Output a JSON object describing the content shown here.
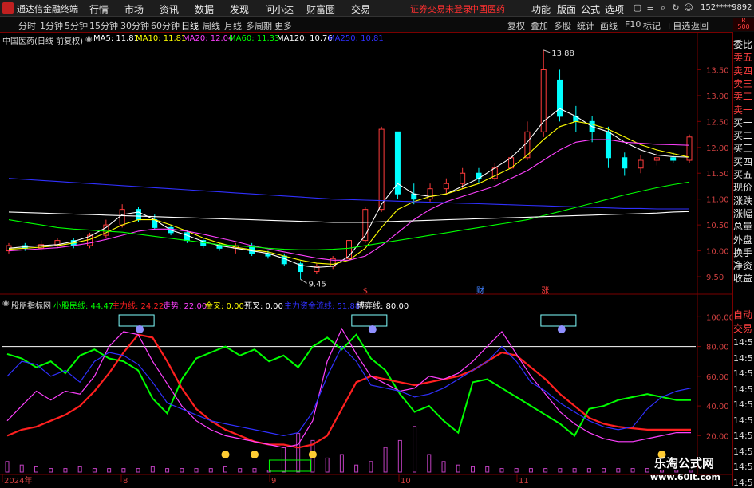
{
  "titlebar": {
    "app_title": "通达信金融终端",
    "menus": [
      "行情",
      "市场",
      "资讯",
      "数据",
      "发现",
      "问小达",
      "财富圈",
      "交易"
    ],
    "warning": "证券交易未登录",
    "stock_name": "中国医药",
    "right_menus": [
      "功能",
      "版面",
      "公式",
      "选项"
    ],
    "phone": "152****9892"
  },
  "toolbar": {
    "periods": [
      "分时",
      "1分钟",
      "5分钟",
      "15分钟",
      "30分钟",
      "60分钟",
      "日线",
      "周线",
      "月线",
      "多周期",
      "更多"
    ],
    "active_period": "日线",
    "right_buttons": [
      "复权",
      "叠加",
      "多股",
      "统计",
      "画线",
      "F10",
      "标记",
      "+自选",
      "返回"
    ]
  },
  "main_chart_info": {
    "title": "中国医药(日线 前复权)",
    "ma": [
      {
        "label": "MA5: 11.81",
        "color": "#ffffff"
      },
      {
        "label": "MA10: 11.81",
        "color": "#ffff00"
      },
      {
        "label": "MA20: 12.04",
        "color": "#ff40ff"
      },
      {
        "label": "MA60: 11.33",
        "color": "#00ff00"
      },
      {
        "label": "MA120: 10.76",
        "color": "#ffffff"
      },
      {
        "label": "MA250: 10.81",
        "color": "#3030ff"
      }
    ]
  },
  "indicator_info": {
    "title": "股朋指标网",
    "items": [
      {
        "label": "小股民线: 44.47",
        "color": "#00ff00"
      },
      {
        "label": "主力线: 24.22",
        "color": "#ff2020"
      },
      {
        "label": "走势: 22.00",
        "color": "#ff40ff"
      },
      {
        "label": "金叉: 0.00",
        "color": "#ffff00"
      },
      {
        "label": "死叉: 0.00",
        "color": "#ffffff"
      },
      {
        "label": "主力资金流线: 51.88",
        "color": "#3030ff"
      },
      {
        "label": "博弈线: 80.00",
        "color": "#ffffff"
      }
    ]
  },
  "chart_data": [
    {
      "type": "line",
      "name": "price",
      "y_ticks": [
        13.5,
        13.0,
        12.5,
        12.0,
        11.5,
        11.0,
        10.5,
        10.0,
        9.5
      ],
      "ylim": [
        9.3,
        14.0
      ],
      "annotations": [
        {
          "text": "13.88",
          "value": 13.88
        },
        {
          "text": "9.45",
          "value": 9.45
        }
      ],
      "event_markers": [
        "$",
        "财",
        "涨"
      ],
      "x_labels": [
        "2024年",
        "8",
        "9",
        "10",
        "11"
      ],
      "series": [
        {
          "name": "MA5",
          "color": "#ffffff",
          "values": [
            10.05,
            10.08,
            10.1,
            10.12,
            10.18,
            10.28,
            10.45,
            10.7,
            10.75,
            10.6,
            10.4,
            10.3,
            10.18,
            10.1,
            10.05,
            10.0,
            9.95,
            9.85,
            9.72,
            9.68,
            9.7,
            9.9,
            10.3,
            10.9,
            11.3,
            11.1,
            11.05,
            11.1,
            11.25,
            11.4,
            11.6,
            11.8,
            12.1,
            12.5,
            12.75,
            12.6,
            12.4,
            12.3,
            12.1,
            11.95,
            11.85,
            11.82,
            11.81
          ]
        },
        {
          "name": "MA10",
          "color": "#ffff00",
          "values": [
            10.03,
            10.05,
            10.07,
            10.1,
            10.15,
            10.22,
            10.35,
            10.5,
            10.6,
            10.6,
            10.5,
            10.38,
            10.25,
            10.15,
            10.07,
            10.02,
            9.98,
            9.9,
            9.82,
            9.76,
            9.74,
            9.82,
            10.05,
            10.45,
            10.8,
            10.95,
            11.05,
            11.1,
            11.2,
            11.3,
            11.45,
            11.6,
            11.85,
            12.15,
            12.4,
            12.5,
            12.45,
            12.35,
            12.2,
            12.05,
            11.95,
            11.88,
            11.81
          ]
        },
        {
          "name": "MA20",
          "color": "#ff40ff",
          "values": [
            10.0,
            10.02,
            10.04,
            10.06,
            10.1,
            10.15,
            10.22,
            10.3,
            10.38,
            10.42,
            10.42,
            10.38,
            10.32,
            10.25,
            10.18,
            10.1,
            10.04,
            9.98,
            9.92,
            9.86,
            9.82,
            9.82,
            9.9,
            10.1,
            10.35,
            10.6,
            10.8,
            10.95,
            11.05,
            11.15,
            11.25,
            11.4,
            11.55,
            11.75,
            11.95,
            12.1,
            12.15,
            12.15,
            12.1,
            12.08,
            12.06,
            12.05,
            12.04
          ]
        },
        {
          "name": "MA60",
          "color": "#00ff00",
          "values": [
            10.6,
            10.55,
            10.5,
            10.45,
            10.42,
            10.4,
            10.38,
            10.36,
            10.32,
            10.28,
            10.24,
            10.2,
            10.16,
            10.12,
            10.1,
            10.08,
            10.05,
            10.03,
            10.02,
            10.02,
            10.03,
            10.05,
            10.1,
            10.15,
            10.2,
            10.25,
            10.3,
            10.35,
            10.4,
            10.45,
            10.5,
            10.55,
            10.6,
            10.68,
            10.76,
            10.84,
            10.92,
            11.0,
            11.08,
            11.15,
            11.22,
            11.28,
            11.33
          ]
        },
        {
          "name": "MA120",
          "color": "#ffffff",
          "values": [
            10.75,
            10.74,
            10.73,
            10.72,
            10.71,
            10.7,
            10.69,
            10.68,
            10.67,
            10.66,
            10.65,
            10.64,
            10.63,
            10.62,
            10.61,
            10.6,
            10.59,
            10.58,
            10.57,
            10.56,
            10.55,
            10.55,
            10.55,
            10.56,
            10.57,
            10.58,
            10.59,
            10.6,
            10.61,
            10.62,
            10.63,
            10.64,
            10.65,
            10.66,
            10.67,
            10.68,
            10.69,
            10.7,
            10.71,
            10.72,
            10.73,
            10.75,
            10.76
          ]
        },
        {
          "name": "MA250",
          "color": "#3030ff",
          "values": [
            11.4,
            11.38,
            11.36,
            11.34,
            11.32,
            11.3,
            11.28,
            11.26,
            11.24,
            11.22,
            11.2,
            11.18,
            11.16,
            11.14,
            11.12,
            11.1,
            11.08,
            11.06,
            11.04,
            11.02,
            11.0,
            10.99,
            10.98,
            10.97,
            10.96,
            10.95,
            10.94,
            10.93,
            10.92,
            10.91,
            10.9,
            10.89,
            10.88,
            10.87,
            10.86,
            10.85,
            10.84,
            10.83,
            10.82,
            10.82,
            10.81,
            10.81,
            10.81
          ]
        }
      ],
      "candles": [
        [
          10.0,
          10.1,
          9.95,
          10.15
        ],
        [
          10.1,
          10.05,
          10.0,
          10.15
        ],
        [
          10.05,
          10.12,
          10.0,
          10.2
        ],
        [
          10.1,
          10.2,
          10.05,
          10.25
        ],
        [
          10.2,
          10.1,
          10.05,
          10.25
        ],
        [
          10.1,
          10.3,
          10.05,
          10.35
        ],
        [
          10.3,
          10.5,
          10.25,
          10.6
        ],
        [
          10.5,
          10.8,
          10.45,
          10.9
        ],
        [
          10.8,
          10.6,
          10.55,
          10.85
        ],
        [
          10.6,
          10.45,
          10.4,
          10.7
        ],
        [
          10.45,
          10.35,
          10.3,
          10.5
        ],
        [
          10.35,
          10.2,
          10.15,
          10.4
        ],
        [
          10.2,
          10.1,
          10.05,
          10.25
        ],
        [
          10.1,
          10.05,
          10.0,
          10.15
        ],
        [
          10.05,
          10.1,
          9.95,
          10.15
        ],
        [
          10.1,
          9.95,
          9.9,
          10.15
        ],
        [
          9.95,
          9.9,
          9.85,
          10.0
        ],
        [
          9.9,
          9.75,
          9.7,
          9.95
        ],
        [
          9.75,
          9.6,
          9.45,
          9.8
        ],
        [
          9.6,
          9.7,
          9.55,
          9.75
        ],
        [
          9.7,
          9.85,
          9.65,
          9.9
        ],
        [
          9.85,
          10.2,
          9.8,
          10.25
        ],
        [
          10.2,
          10.8,
          10.15,
          10.85
        ],
        [
          10.8,
          12.35,
          10.75,
          12.4
        ],
        [
          12.3,
          11.1,
          11.0,
          12.3
        ],
        [
          11.1,
          11.0,
          10.9,
          11.3
        ],
        [
          11.0,
          11.2,
          10.95,
          11.3
        ],
        [
          11.2,
          11.3,
          11.1,
          11.4
        ],
        [
          11.3,
          11.5,
          11.2,
          11.6
        ],
        [
          11.5,
          11.4,
          11.3,
          11.6
        ],
        [
          11.4,
          11.6,
          11.35,
          11.7
        ],
        [
          11.6,
          11.8,
          11.55,
          11.9
        ],
        [
          11.8,
          12.3,
          11.75,
          12.5
        ],
        [
          12.3,
          13.5,
          12.2,
          13.88
        ],
        [
          13.3,
          12.6,
          12.5,
          13.5
        ],
        [
          12.6,
          12.5,
          12.3,
          12.8
        ],
        [
          12.5,
          12.3,
          12.1,
          12.6
        ],
        [
          12.3,
          11.8,
          11.6,
          12.4
        ],
        [
          11.8,
          11.6,
          11.45,
          11.9
        ],
        [
          11.6,
          11.75,
          11.5,
          11.85
        ],
        [
          11.75,
          11.8,
          11.65,
          11.9
        ],
        [
          11.8,
          11.75,
          11.7,
          11.9
        ],
        [
          11.75,
          12.2,
          11.7,
          12.25
        ]
      ]
    },
    {
      "type": "line",
      "name": "indicator",
      "y_ticks": [
        100.0,
        80.0,
        60.0,
        40.0,
        20.0
      ],
      "ylim": [
        10,
        105
      ],
      "threshold": 80,
      "series": [
        {
          "name": "小股民线",
          "color": "#00ff00",
          "values": [
            75,
            72,
            66,
            70,
            62,
            74,
            78,
            72,
            70,
            64,
            45,
            35,
            58,
            72,
            76,
            80,
            74,
            78,
            70,
            74,
            66,
            80,
            86,
            78,
            88,
            72,
            64,
            48,
            36,
            40,
            30,
            22,
            56,
            58,
            52,
            46,
            40,
            34,
            28,
            20,
            38,
            40,
            44,
            46,
            48,
            46,
            44,
            44
          ]
        },
        {
          "name": "主力线",
          "color": "#ff2020",
          "values": [
            20,
            24,
            26,
            30,
            34,
            40,
            50,
            62,
            76,
            88,
            86,
            70,
            52,
            38,
            30,
            24,
            20,
            16,
            14,
            14,
            12,
            14,
            20,
            38,
            56,
            60,
            58,
            56,
            54,
            56,
            58,
            60,
            64,
            70,
            76,
            74,
            66,
            58,
            48,
            40,
            32,
            28,
            26,
            25,
            24,
            24,
            24,
            24
          ]
        },
        {
          "name": "走势",
          "color": "#ff40ff",
          "values": [
            30,
            40,
            50,
            44,
            50,
            48,
            60,
            80,
            90,
            88,
            70,
            55,
            40,
            30,
            24,
            20,
            18,
            16,
            14,
            12,
            14,
            30,
            70,
            92,
            75,
            60,
            55,
            50,
            52,
            60,
            58,
            62,
            70,
            80,
            90,
            75,
            60,
            48,
            36,
            28,
            22,
            18,
            16,
            16,
            18,
            20,
            22,
            22
          ]
        },
        {
          "name": "主力资金流线",
          "color": "#3030ff",
          "values": [
            60,
            70,
            68,
            60,
            64,
            56,
            70,
            76,
            74,
            68,
            56,
            42,
            38,
            34,
            30,
            28,
            26,
            24,
            22,
            20,
            22,
            36,
            60,
            80,
            70,
            54,
            52,
            50,
            46,
            48,
            52,
            58,
            64,
            70,
            80,
            70,
            56,
            50,
            42,
            36,
            30,
            26,
            24,
            26,
            38,
            46,
            50,
            52
          ]
        }
      ],
      "volume": [
        6,
        4,
        3,
        2,
        2,
        3,
        2,
        2,
        2,
        2,
        3,
        2,
        2,
        2,
        2,
        3,
        2,
        2,
        1,
        14,
        22,
        18,
        8,
        10,
        4,
        6,
        14,
        18,
        26,
        10,
        6,
        4,
        3,
        3,
        2,
        2,
        2,
        2,
        2,
        2,
        2,
        2,
        2,
        2,
        2,
        1,
        1,
        1
      ]
    }
  ],
  "right_panel": {
    "labels": [
      "委比",
      "卖五",
      "卖四",
      "卖三",
      "卖二",
      "卖一",
      "买一",
      "买二",
      "买三",
      "买四",
      "买五",
      "现价",
      "涨跌",
      "涨幅",
      "总量",
      "外盘",
      "换手",
      "净资",
      "收益",
      "自动",
      "交易"
    ],
    "times": [
      "14:5",
      "14:5",
      "14:5",
      "14:5",
      "14:5",
      "14:5",
      "14:5",
      "14:5",
      "14:5",
      "14:5"
    ]
  },
  "watermark": {
    "line1": "乐淘公式网",
    "line2": "www.60lt.com"
  }
}
